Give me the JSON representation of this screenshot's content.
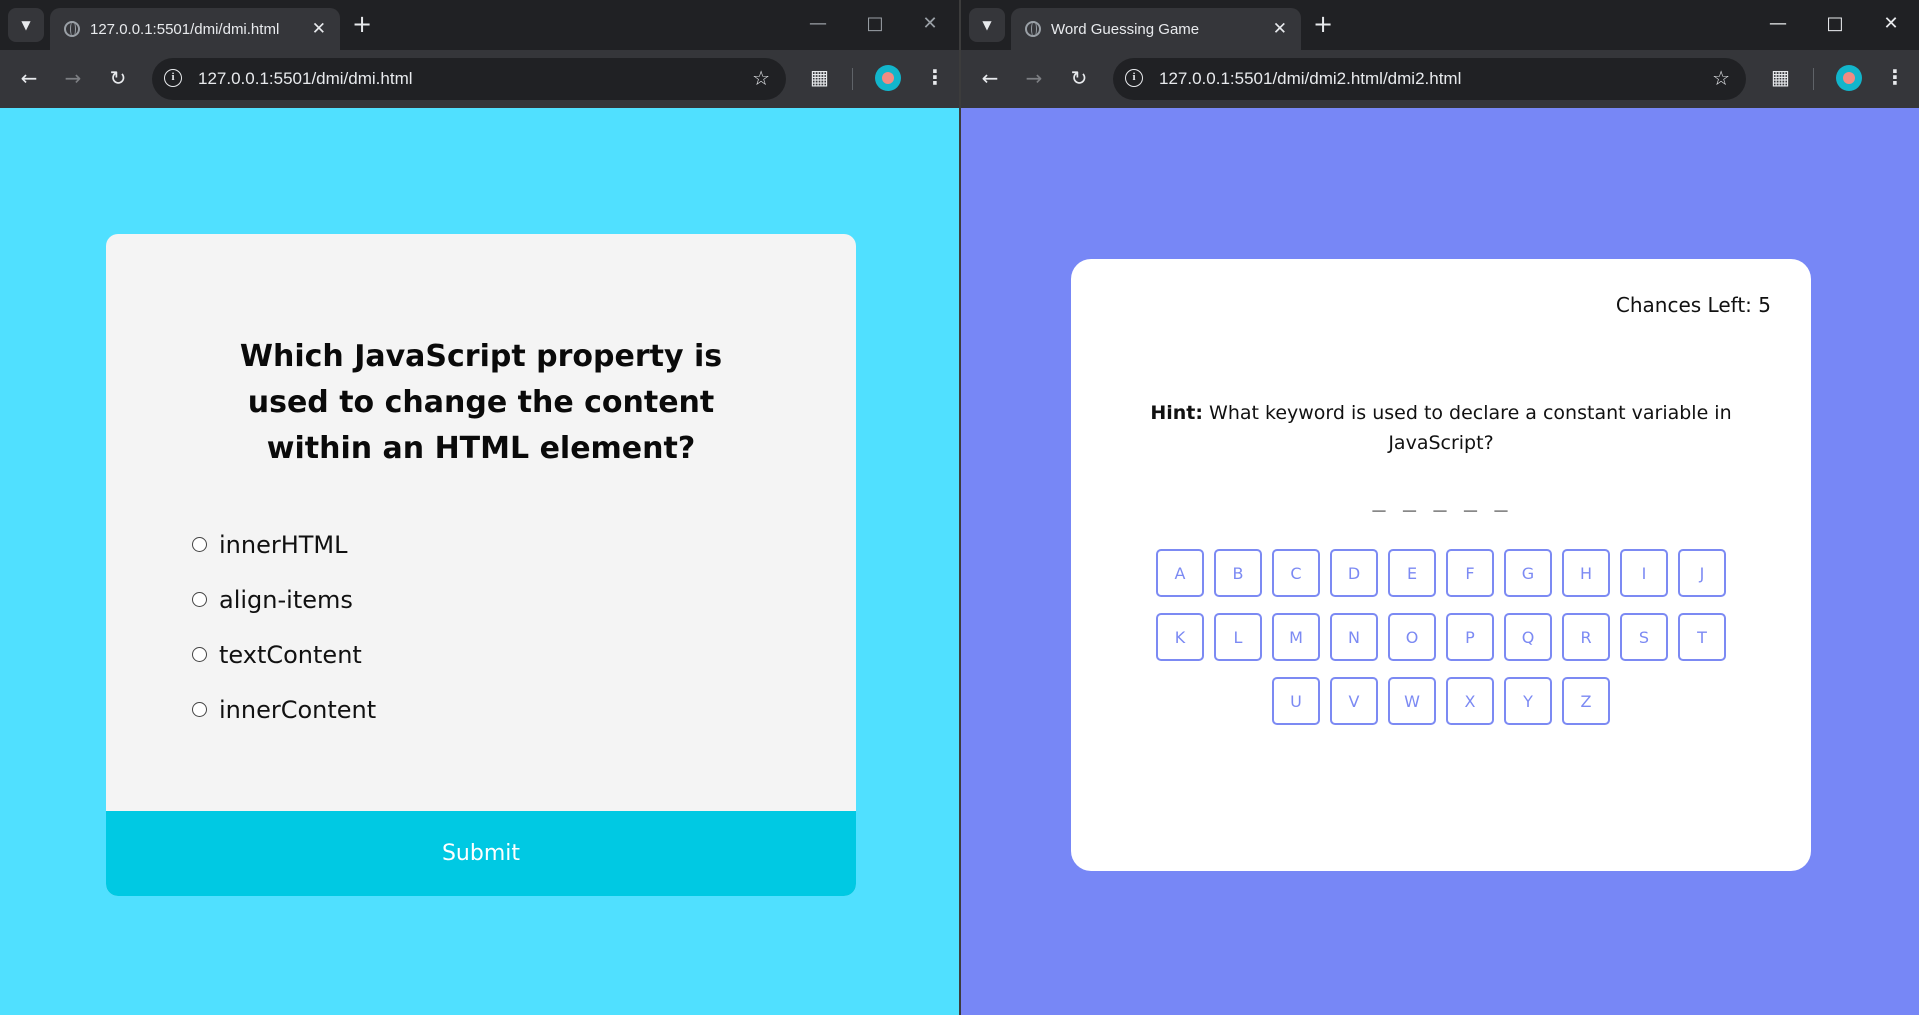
{
  "left_window": {
    "tab_title": "127.0.0.1:5501/dmi/dmi.html",
    "url": "127.0.0.1:5501/dmi/dmi.html",
    "quiz": {
      "question": "Which JavaScript property is used to change the content within an HTML element?",
      "options": [
        "innerHTML",
        "align-items",
        "textContent",
        "innerContent"
      ],
      "submit_label": "Submit"
    }
  },
  "right_window": {
    "tab_title": "Word Guessing Game",
    "url": "127.0.0.1:5501/dmi/dmi2.html/dmi2.html",
    "game": {
      "chances_label": "Chances Left: 5",
      "hint_label": "Hint:",
      "hint_text": "What keyword is used to declare a constant variable in JavaScript?",
      "blanks": "_ _ _ _ _",
      "letters": [
        "A",
        "B",
        "C",
        "D",
        "E",
        "F",
        "G",
        "H",
        "I",
        "J",
        "K",
        "L",
        "M",
        "N",
        "O",
        "P",
        "Q",
        "R",
        "S",
        "T",
        "U",
        "V",
        "W",
        "X",
        "Y",
        "Z"
      ]
    }
  },
  "colors": {
    "quiz_background": "#50e0ff",
    "quiz_submit": "#00c9e3",
    "game_background": "#7787f6",
    "key_accent": "#7c8af3"
  },
  "icons": [
    "tab-list-icon",
    "globe-icon",
    "close-icon",
    "new-tab-icon",
    "minimize-icon",
    "maximize-icon",
    "back-icon",
    "forward-icon",
    "reload-icon",
    "site-info-icon",
    "bookmark-star-icon",
    "extensions-icon",
    "profile-avatar",
    "more-menu-icon"
  ]
}
